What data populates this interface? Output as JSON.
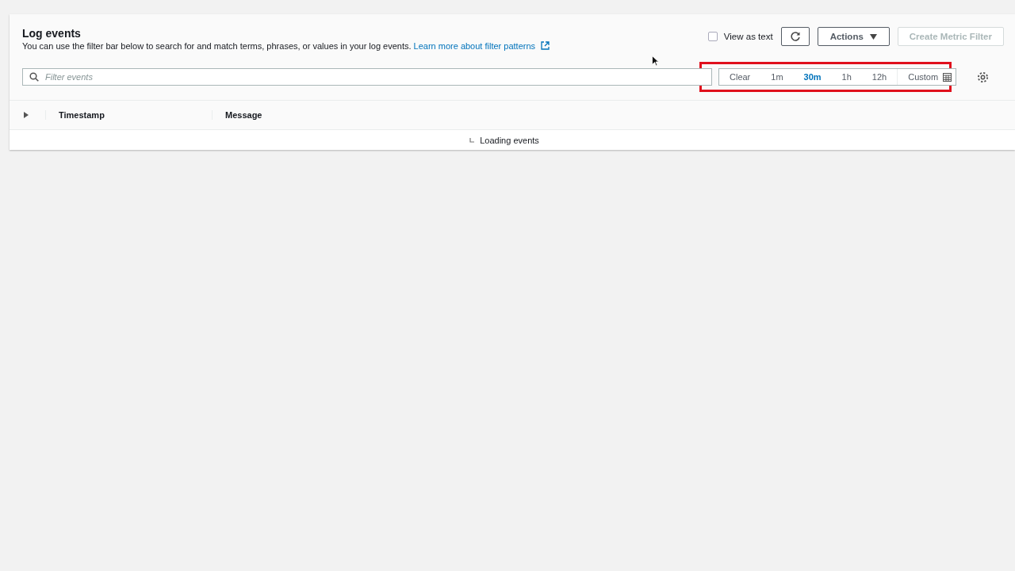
{
  "panel": {
    "title": "Log events",
    "description": "You can use the filter bar below to search for and match terms, phrases, or values in your log events.",
    "learn_link": "Learn more about filter patterns"
  },
  "toolbar": {
    "view_as_text": {
      "label": "View as text",
      "checked": false
    },
    "actions_label": "Actions",
    "create_filter": {
      "label": "Create Metric Filter",
      "disabled": true
    }
  },
  "filter": {
    "placeholder": "Filter events"
  },
  "time_range": {
    "highlighted": true,
    "options": [
      {
        "label": "Clear",
        "selected": false
      },
      {
        "label": "1m",
        "selected": false
      },
      {
        "label": "30m",
        "selected": true
      },
      {
        "label": "1h",
        "selected": false
      },
      {
        "label": "12h",
        "selected": false
      },
      {
        "label": "Custom",
        "selected": false
      }
    ]
  },
  "table": {
    "columns": [
      "Timestamp",
      "Message"
    ],
    "status": "Loading events"
  }
}
